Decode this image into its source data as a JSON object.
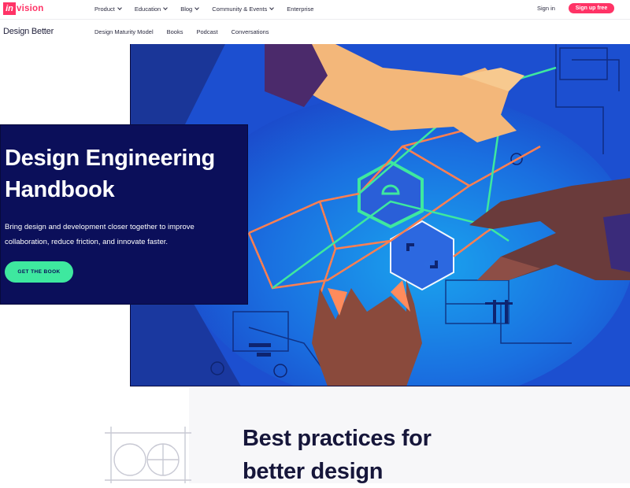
{
  "topnav": {
    "logo_prefix": "in",
    "logo_text": "vision",
    "items": [
      {
        "label": "Product",
        "has_dropdown": true
      },
      {
        "label": "Education",
        "has_dropdown": true
      },
      {
        "label": "Blog",
        "has_dropdown": true
      },
      {
        "label": "Community & Events",
        "has_dropdown": true
      },
      {
        "label": "Enterprise",
        "has_dropdown": false
      }
    ],
    "signin": "Sign in",
    "signup": "Sign up free"
  },
  "subnav": {
    "brand": "Design Better",
    "items": [
      "Design Maturity Model",
      "Books",
      "Podcast",
      "Conversations"
    ]
  },
  "hero": {
    "title": "Design Engineering Handbook",
    "subtitle": "Bring design and development closer together to improve collaboration, reduce friction, and innovate faster.",
    "cta": "GET THE BOOK"
  },
  "section": {
    "title": "Best practices for better design"
  },
  "colors": {
    "brand_pink": "#ff3366",
    "hero_navy": "#0b0f5a",
    "cta_green": "#3ee89f",
    "illustration_blue": "#1e5bd8"
  }
}
